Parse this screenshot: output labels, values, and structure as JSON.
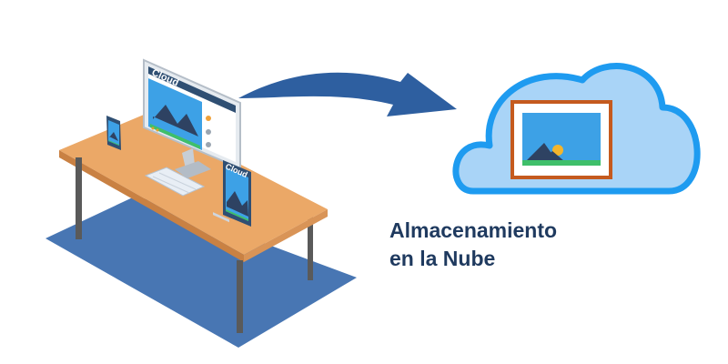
{
  "caption": {
    "line1": "Almacenamiento",
    "line2": "en la Nube"
  },
  "monitor": {
    "screen_label": "Cloud"
  },
  "tablet": {
    "screen_label": "Cloud"
  },
  "colors": {
    "floor_mat": "#4876b3",
    "desk_top": "#e8a664",
    "cloud_fill": "#a9d4f7",
    "cloud_stroke": "#1e9bf0",
    "arrow": "#2e5fa0",
    "frame": "#c55a1e",
    "caption_text": "#1f3a5f"
  },
  "icons": [
    "cloud-icon",
    "image-icon",
    "arrow-icon",
    "monitor-icon",
    "tablet-icon",
    "phone-icon",
    "keyboard-icon"
  ]
}
